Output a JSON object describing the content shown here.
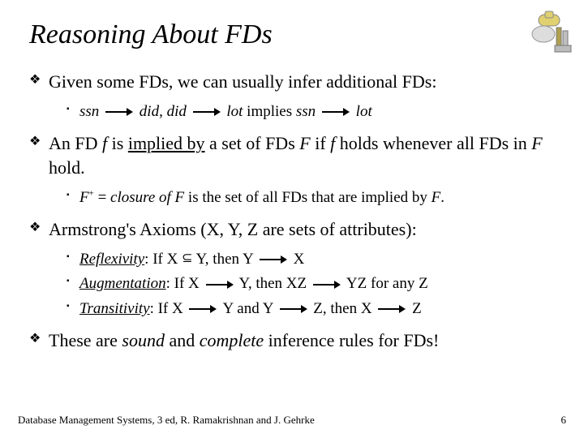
{
  "title": "Reasoning About FDs",
  "bullets": {
    "b1": {
      "text": "Given some FDs, we can usually infer additional FDs:",
      "sub": {
        "ssn": "ssn",
        "did1": "did",
        "comma": ", ",
        "did2": "did",
        "lot1": "lot",
        "implies": "   implies   ",
        "ssn2": "ssn",
        "lot2": "lot"
      }
    },
    "b2": {
      "pre": "An FD ",
      "f": "f",
      "mid1": " is ",
      "implied_by": "implied by",
      "mid2": " a set of FDs ",
      "F": "F",
      "mid3": " if ",
      "f2": "f ",
      "mid4": " holds whenever all FDs in ",
      "F2": "F",
      "end": " hold.",
      "sub": {
        "fplus_pre": " = ",
        "closure": "closure of F",
        "rest": " is the set of all FDs that are implied by ",
        "F": "F",
        "dot": "."
      }
    },
    "b3": {
      "text": "Armstrong's Axioms (X, Y, Z are sets of attributes):",
      "ax1": {
        "name": "Reflexivity",
        "col": ":  If  X ",
        "mid": " Y,  then   Y ",
        "end": " X"
      },
      "ax2": {
        "name": "Augmentation",
        "col": ":   If  X ",
        "mid": " Y,  then  XZ ",
        "end": " YZ   for any Z"
      },
      "ax3": {
        "name": "Transitivity",
        "col": ":   If  X ",
        "mid1": " Y  and  Y ",
        "mid2": " Z,  then   X ",
        "end": " Z"
      }
    },
    "b4": {
      "pre": "These are ",
      "sound": "sound",
      "mid": " and ",
      "complete": "complete",
      "end": " inference rules for FDs!"
    }
  },
  "footer": {
    "left": "Database Management Systems, 3 ed, R. Ramakrishnan and J. Gehrke",
    "right": "6"
  }
}
